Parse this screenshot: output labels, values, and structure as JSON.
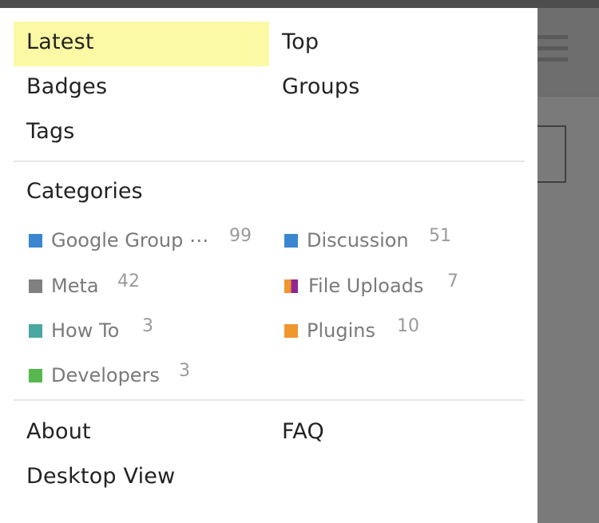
{
  "nav": {
    "latest": "Latest",
    "top": "Top",
    "badges": "Badges",
    "groups": "Groups",
    "tags": "Tags"
  },
  "categories": {
    "heading": "Categories",
    "items": [
      {
        "name": "Google Group ⋯",
        "count": "99",
        "color": "#3a86d0"
      },
      {
        "name": "Discussion",
        "count": "51",
        "color": "#3a86d0"
      },
      {
        "name": "Meta",
        "count": "42",
        "color": "#808080"
      },
      {
        "name": "File Uploads",
        "count": "7",
        "colors": [
          "#f0962e",
          "#92278f"
        ]
      },
      {
        "name": "How To",
        "count": "3",
        "color": "#4aa8a0"
      },
      {
        "name": "Plugins",
        "count": "10",
        "color": "#f0962e"
      },
      {
        "name": "Developers",
        "count": "3",
        "color": "#56b84e"
      }
    ]
  },
  "footer": {
    "about": "About",
    "faq": "FAQ",
    "desktop_view": "Desktop View"
  }
}
